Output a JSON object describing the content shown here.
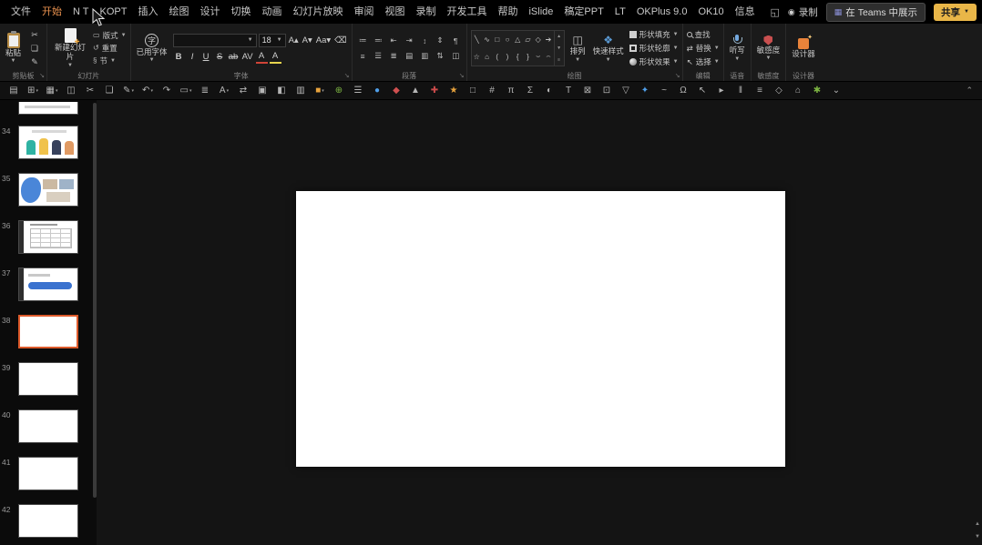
{
  "titlebar": {
    "tabs": [
      "文件",
      "开始",
      "N T",
      "KOPT",
      "插入",
      "绘图",
      "设计",
      "切换",
      "动画",
      "幻灯片放映",
      "审阅",
      "视图",
      "录制",
      "开发工具",
      "帮助",
      "iSlide",
      "稿定PPT",
      "LT",
      "OKPlus 9.0",
      "OK10",
      "信息"
    ],
    "active_tab": "开始",
    "record": "录制",
    "teams_present": "在 Teams 中展示",
    "share": "共享"
  },
  "ribbon": {
    "groups": {
      "clipboard": {
        "label": "剪贴板",
        "paste": "粘贴"
      },
      "slides": {
        "label": "幻灯片",
        "new_slide": "新建幻灯片",
        "layout": "版式",
        "reset": "重置",
        "section": "节"
      },
      "font": {
        "label": "字体",
        "used_font": "已用字体",
        "size": "18",
        "buttons": [
          {
            "g": "B",
            "cls": "b",
            "name": "bold-button"
          },
          {
            "g": "I",
            "cls": "i",
            "name": "italic-button"
          },
          {
            "g": "U",
            "cls": "u",
            "name": "underline-button"
          },
          {
            "g": "S",
            "cls": "s",
            "name": "strikethrough-button"
          },
          {
            "g": "ab",
            "cls": "s",
            "name": "strikethrough-ab-button"
          },
          {
            "g": "AV",
            "cls": "",
            "name": "character-spacing-button"
          },
          {
            "g": "A",
            "cls": "fontcolor",
            "name": "font-color-button"
          },
          {
            "g": "A",
            "cls": "highlight",
            "name": "text-highlight-button"
          }
        ]
      },
      "paragraph": {
        "label": "段落",
        "row1": [
          "≔",
          "≕",
          "⇤",
          "⇥",
          "↕",
          "⇕",
          "¶"
        ],
        "row2": [
          "≡",
          "☰",
          "≣",
          "▤",
          "▥",
          "⇅",
          "◫"
        ]
      },
      "drawing": {
        "label": "绘图",
        "shapes": [
          "╲",
          "∿",
          "□",
          "○",
          "△",
          "▱",
          "◇",
          "➔",
          "☆",
          "⌂",
          "(",
          ")",
          "{",
          "}",
          "⌣",
          "⌢"
        ],
        "arrange": "排列",
        "quick_styles": "快速样式",
        "shape_fill": "形状填充",
        "shape_outline": "形状轮廓",
        "shape_effects": "形状效果"
      },
      "editing": {
        "label": "编辑",
        "find": "查找",
        "replace": "替换",
        "select": "选择"
      },
      "voice": {
        "label": "语音",
        "dictate": "听写"
      },
      "sensitivity": {
        "label": "敏感度",
        "button": "敏感度"
      },
      "designer": {
        "label": "设计器",
        "button": "设计器"
      }
    }
  },
  "quick_toolbar": {
    "icons": [
      {
        "g": "▤"
      },
      {
        "g": "⊞",
        "caret": true
      },
      {
        "g": "▦",
        "caret": true
      },
      {
        "g": "◫"
      },
      {
        "g": "✂"
      },
      {
        "g": "❏"
      },
      {
        "g": "✎",
        "caret": true
      },
      {
        "g": "↶",
        "caret": true
      },
      {
        "g": "↷"
      },
      {
        "g": "▭",
        "caret": true
      },
      {
        "g": "≣"
      },
      {
        "g": "A",
        "caret": true
      },
      {
        "g": "⇄"
      },
      {
        "g": "▣"
      },
      {
        "g": "◧"
      },
      {
        "g": "▥"
      },
      {
        "g": "■",
        "c": "#e8a33d",
        "caret": true
      },
      {
        "g": "⊕",
        "c": "#7cb342"
      },
      {
        "g": "☰"
      },
      {
        "g": "●",
        "c": "#4f9ee8"
      },
      {
        "g": "◆",
        "c": "#d05050"
      },
      {
        "g": "▲"
      },
      {
        "g": "✚",
        "c": "#cb4b4b"
      },
      {
        "g": "★",
        "c": "#e8a33d"
      },
      {
        "g": "□"
      },
      {
        "g": "#"
      },
      {
        "g": "π"
      },
      {
        "g": "Σ"
      },
      {
        "g": "◐"
      },
      {
        "g": "T"
      },
      {
        "g": "⊠"
      },
      {
        "g": "⊡"
      },
      {
        "g": "▽"
      },
      {
        "g": "✦",
        "c": "#4f9ee8"
      },
      {
        "g": "~"
      },
      {
        "g": "Ω"
      },
      {
        "g": "↖"
      },
      {
        "g": "▸"
      },
      {
        "g": "‖"
      },
      {
        "g": "≡"
      },
      {
        "g": "◇"
      },
      {
        "g": "⌂"
      },
      {
        "g": "✱",
        "c": "#7cb342"
      },
      {
        "g": "⌄"
      }
    ],
    "collapse": "⌃"
  },
  "slide_panel": {
    "slides": [
      {
        "num": "",
        "kind": "partial"
      },
      {
        "num": "34",
        "kind": "people"
      },
      {
        "num": "35",
        "kind": "collage"
      },
      {
        "num": "36",
        "kind": "table"
      },
      {
        "num": "37",
        "kind": "banner"
      },
      {
        "num": "38",
        "kind": "blank",
        "selected": true
      },
      {
        "num": "39",
        "kind": "blank"
      },
      {
        "num": "40",
        "kind": "blank"
      },
      {
        "num": "41",
        "kind": "blank"
      },
      {
        "num": "42",
        "kind": "blank"
      }
    ]
  },
  "colors": {
    "accent_tab": "#e8914e",
    "selection_border": "#dd5a2b",
    "share_button": "#e9b648",
    "slide_background": "#ffffff"
  }
}
